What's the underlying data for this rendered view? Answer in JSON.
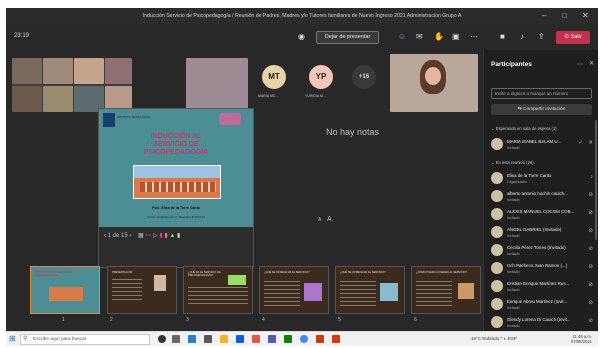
{
  "window": {
    "title": "Inducción Servicio de Psicopedagogía / Reunión de Padres, Madres y/o Tutores familiares de Nuevo Ingreso 2021 Administracion Grupo A",
    "minimize": "–",
    "maximize": "□",
    "close": "✕"
  },
  "toolbar": {
    "time": "23:19",
    "stop_presenting": "Dejar de presentar",
    "leave": "Salir"
  },
  "stage": {
    "avatars": [
      {
        "initials": "MT",
        "label": "MARIA MC...",
        "color": "#e8d3a6"
      },
      {
        "initials": "YP",
        "label": "YURIDIA M...",
        "color": "#f3c6b8"
      }
    ],
    "overflow": "+16",
    "no_notes": "No hay notas",
    "slide_counter": "1 de 15",
    "zoom_out": "A",
    "zoom_in": "A"
  },
  "slide": {
    "title_line1": "INDUCCIÓN AL",
    "title_line2": "SERVICIO DE",
    "title_line3": "PSICOPEDAGOGÍA",
    "presenter": "Psic. Elisa de la Torre Canto",
    "footer": "Correo: edtc@itsrv.edu.mx | WhatsApp: 9XXXXXXX",
    "org": "INSTITUTO TECNOLÓGICO"
  },
  "thumbnails": [
    {
      "num": "1",
      "caption": "INDUCCIÓN AL SERVICIO DE PSICOPEDAGOGÍA"
    },
    {
      "num": "2",
      "caption": "PRESENTACIÓN"
    },
    {
      "num": "3",
      "caption": "¿QUÉ ES EL SERVICIO DE PSICOPEDAGOGÍA?"
    },
    {
      "num": "4",
      "caption": "¿QUÉ SE OFRECE EN EL SERVICIO?"
    },
    {
      "num": "5",
      "caption": "¿QUÉ SE OFRECE EN EL SERVICIO?"
    },
    {
      "num": "6",
      "caption": "¿CÓMO PUEDO ACCEDER AL SERVICIO?"
    }
  ],
  "panel": {
    "title": "Participantes",
    "invite_placeholder": "Invite a alguien o marque un número",
    "share_invite": "Compartir invitación",
    "lobby_header": "Esperando en sala de espera (1)",
    "in_meeting_header": "En esta reunión (26)",
    "lobby": [
      {
        "name": "MARIA ISABEL BALAM U...",
        "role": "Invitado"
      }
    ],
    "participants": [
      {
        "name": "Elisa de la Torre Canto",
        "role": "Organizador"
      },
      {
        "name": "alberto antonio huchin cauich...",
        "role": "Invitado"
      },
      {
        "name": "ALEXIS MANUEL COCOM COB...",
        "role": "Invitado"
      },
      {
        "name": "ANGEL GABRIEL (Invitado)",
        "role": "Invitado"
      },
      {
        "name": "Cecilia Pérez Torres (Invitado)",
        "role": "Invitado"
      },
      {
        "name": "Cch Pacheco Juan Ramon (...)",
        "role": "Invitado"
      },
      {
        "name": "Cristian Enrique Martínez Rus...",
        "role": "Invitado"
      },
      {
        "name": "Enrique Abreu Martinez (Invit...",
        "role": "Invitado"
      },
      {
        "name": "Glendy Lorena Di Cauich (Invit...",
        "role": "Invitado"
      }
    ]
  },
  "taskbar": {
    "search_placeholder": "Escribe aquí para buscar",
    "weather": "19°C Nublado",
    "lang": "ESP",
    "clock_time": "11:49 a.m.",
    "clock_date": "07/08/2021"
  }
}
